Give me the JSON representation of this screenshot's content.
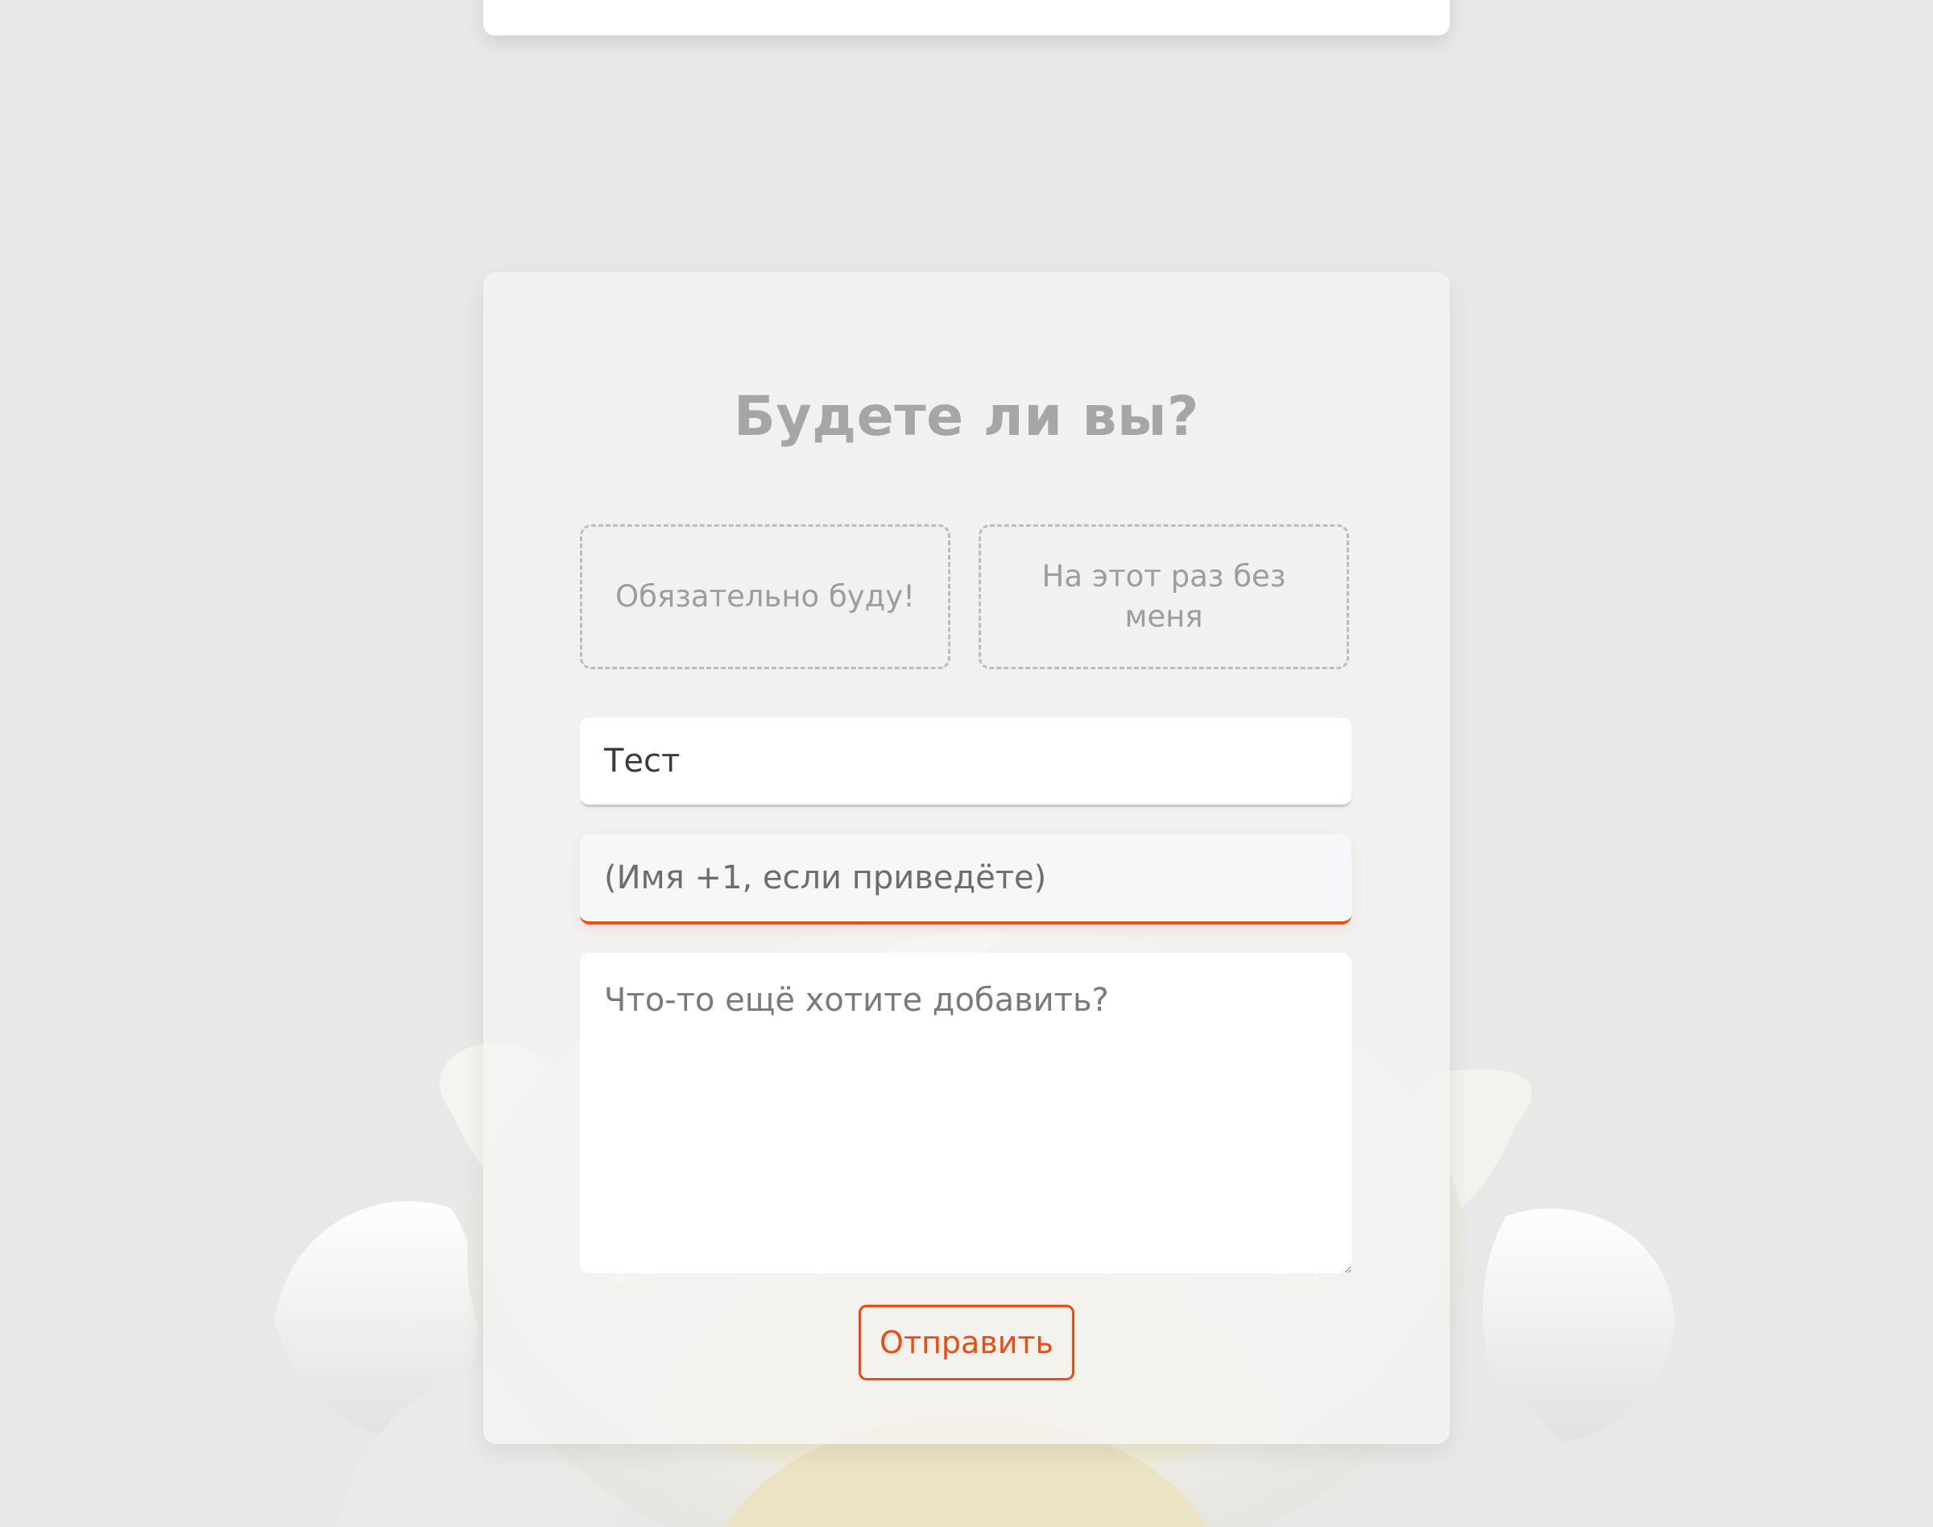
{
  "rsvp": {
    "title": "Будете ли вы?",
    "options": {
      "yes_label": "Обязательно буду!",
      "no_label": "На этот раз без меня"
    },
    "name_field": {
      "value": "Тест"
    },
    "guest_field": {
      "placeholder": "(Имя +1, если приведёте)"
    },
    "comment_field": {
      "placeholder": "Что-то ещё хотите добавить?"
    },
    "submit_label": "Отправить"
  },
  "colors": {
    "accent": "#ef4c12",
    "background": "#e8e8e8",
    "title": "#a6a6a6"
  },
  "icons": {
    "background_decoration": "white-rose-illustration"
  }
}
